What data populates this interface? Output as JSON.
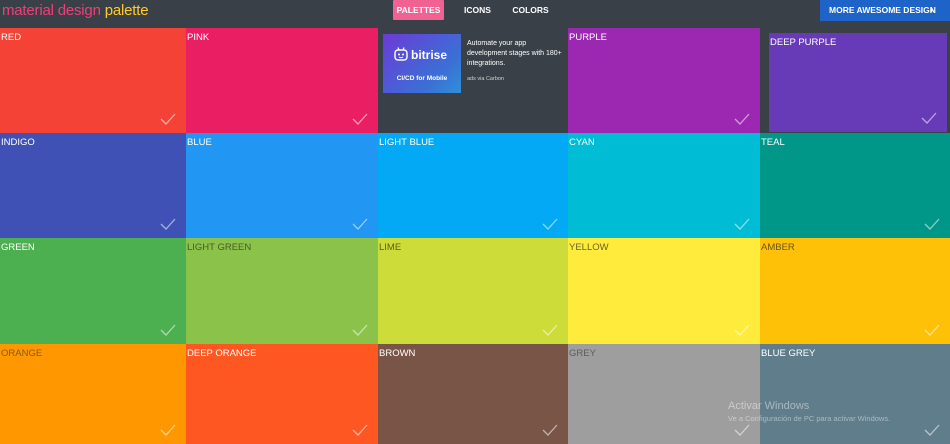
{
  "header": {
    "brand_part1": "material design",
    "brand_part2": "palette",
    "nav": [
      {
        "label": "PALETTES",
        "active": true
      },
      {
        "label": "ICONS",
        "active": false
      },
      {
        "label": "COLORS",
        "active": false
      }
    ],
    "cta_label": "MORE AWESOME DESIGN",
    "cta_icon": "chevron-right-icon"
  },
  "ad": {
    "logo_word": "bitrise",
    "logo_tag": "CI/CD for Mobile",
    "text": "Automate your app development stages with 180+ integrations.",
    "via": "ads via Carbon"
  },
  "colors": [
    {
      "label": "RED",
      "hex": "#f44336",
      "text": "#ffffff"
    },
    {
      "label": "PINK",
      "hex": "#e91e63",
      "text": "#ffffff"
    },
    {
      "label": "PURPLE",
      "hex": "#9c27b0",
      "text": "#ffffff"
    },
    {
      "label": "DEEP PURPLE",
      "hex": "#673ab7",
      "text": "#ffffff"
    },
    {
      "label": "INDIGO",
      "hex": "#3f51b5",
      "text": "#ffffff"
    },
    {
      "label": "BLUE",
      "hex": "#2196f3",
      "text": "#ffffff"
    },
    {
      "label": "LIGHT BLUE",
      "hex": "#03a9f4",
      "text": "#ffffff"
    },
    {
      "label": "CYAN",
      "hex": "#00bcd4",
      "text": "#ffffff"
    },
    {
      "label": "TEAL",
      "hex": "#009688",
      "text": "#ffffff"
    },
    {
      "label": "GREEN",
      "hex": "#4caf50",
      "text": "#ffffff"
    },
    {
      "label": "LIGHT GREEN",
      "hex": "#8bc34a",
      "text": "#4a5a2a"
    },
    {
      "label": "LIME",
      "hex": "#cddc39",
      "text": "#5a5f20"
    },
    {
      "label": "YELLOW",
      "hex": "#ffeb3b",
      "text": "#6a6420"
    },
    {
      "label": "AMBER",
      "hex": "#ffc107",
      "text": "#6a5418"
    },
    {
      "label": "ORANGE",
      "hex": "#ff9800",
      "text": "#8a5a10"
    },
    {
      "label": "DEEP ORANGE",
      "hex": "#ff5722",
      "text": "#ffffff"
    },
    {
      "label": "BROWN",
      "hex": "#795548",
      "text": "#ffffff"
    },
    {
      "label": "GREY",
      "hex": "#9e9e9e",
      "text": "#5d5d5d"
    },
    {
      "label": "BLUE GREY",
      "hex": "#607d8b",
      "text": "#ffffff"
    }
  ],
  "watermark": {
    "line1": "Activar Windows",
    "line2": "Ve a Configuración de PC para activar Windows."
  }
}
